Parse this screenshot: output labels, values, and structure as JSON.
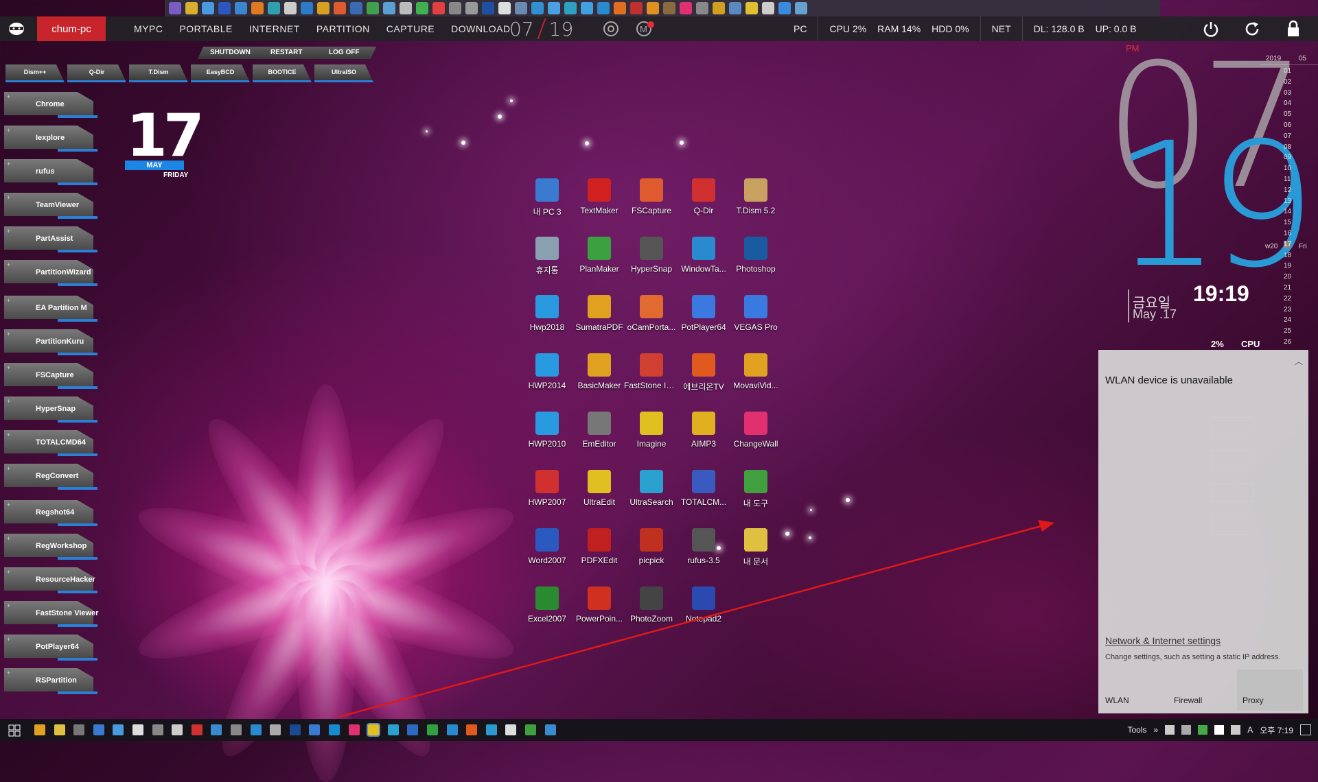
{
  "window": {
    "host": "chum-pc"
  },
  "topbar": {
    "menu": [
      "MYPC",
      "PORTABLE",
      "INTERNET",
      "PARTITION",
      "CAPTURE",
      "DOWNLOAD"
    ],
    "date_month": "07",
    "date_day": "19",
    "pc_label": "PC",
    "cpu": "CPU  2%",
    "ram": "RAM  14%",
    "hdd": "HDD  0%",
    "net_label": "NET",
    "dl": "DL: 128.0 B",
    "up": "UP: 0.0 B"
  },
  "system_buttons": [
    "SHUTDOWN",
    "RESTART",
    "LOG OFF"
  ],
  "tool_buttons": [
    "Dism++",
    "Q-Dir",
    "T.Dism",
    "EasyBCD",
    "BOOTICE",
    "UltraISO"
  ],
  "dock": [
    "Chrome",
    "Iexplore",
    "rufus",
    "TeamViewer",
    "PartAssist",
    "PartitionWizard",
    "EA Partition M",
    "PartitionKuru",
    "FSCapture",
    "HyperSnap",
    "TOTALCMD64",
    "RegConvert",
    "Regshot64",
    "RegWorkshop",
    "ResourceHacker",
    "FastStone Viewer",
    "PotPlayer64",
    "RSPartition"
  ],
  "date_widget": {
    "day": "17",
    "month": "MAY",
    "weekday": "FRIDAY"
  },
  "desktop_icons": [
    [
      "내 PC 3",
      "TextMaker",
      "FSCapture",
      "Q-Dir",
      "T.Dism 5.2"
    ],
    [
      "휴지통",
      "PlanMaker",
      "HyperSnap",
      "WindowTa...",
      "Photoshop"
    ],
    [
      "Hwp2018",
      "SumatraPDF",
      "oCamPorta...",
      "PotPlayer64",
      "VEGAS Pro"
    ],
    [
      "HWP2014",
      "BasicMaker",
      "FastStone Image ...",
      "에브리온TV",
      "MovaviVid..."
    ],
    [
      "HWP2010",
      "EmEditor",
      "Imagine",
      "AIMP3",
      "ChangeWall"
    ],
    [
      "HWP2007",
      "UltraEdit",
      "UltraSearch",
      "TOTALCM...",
      "내 도구"
    ],
    [
      "Word2007",
      "PDFXEdit",
      "picpick",
      "rufus-3.5",
      "내 문서"
    ],
    [
      "Excel2007",
      "PowerPoin...",
      "PhotoZoom",
      "Notepad2",
      ""
    ]
  ],
  "clock": {
    "ampm": "PM",
    "hour": "07",
    "minute": "19",
    "korean_day": "금요일",
    "date": "May .17",
    "digital": "19:19",
    "cpu_pct": "2%",
    "cpu_label": "CPU"
  },
  "calendar": {
    "year": "2019",
    "month": "05",
    "week": "w20",
    "today": "17",
    "today_day": "Fri",
    "days": [
      "01",
      "02",
      "03",
      "04",
      "05",
      "06",
      "07",
      "08",
      "09",
      "10",
      "11",
      "12",
      "13",
      "14",
      "15",
      "16",
      "17",
      "18",
      "19",
      "20",
      "21",
      "22",
      "23",
      "24",
      "25",
      "26"
    ]
  },
  "flyout": {
    "title": "WLAN device is unavailable",
    "link": "Network & Internet settings",
    "subtitle": "Change settings, such as setting a static IP address.",
    "buttons": [
      "WLAN",
      "Firewall",
      "Proxy"
    ]
  },
  "taskbar": {
    "tools_label": "Tools",
    "time": "오후 7:19",
    "lang": "A"
  },
  "colors": {
    "accent": "#1c86e6",
    "host_tab": "#c8242c",
    "minute": "#2a9ad6"
  }
}
